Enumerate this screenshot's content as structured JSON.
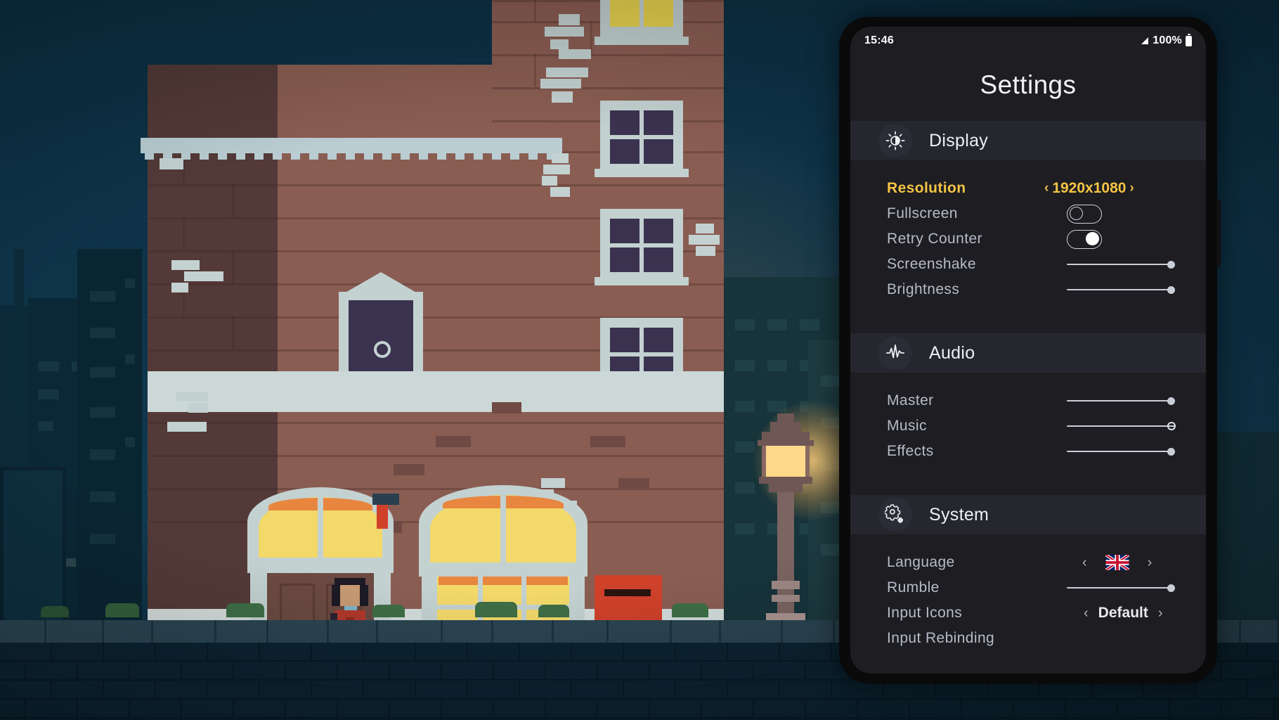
{
  "phone": {
    "status": {
      "time": "15:46",
      "battery": "100%",
      "signal_icon": "signal-icon",
      "battery_icon": "battery-icon"
    },
    "title": "Settings"
  },
  "sections": [
    {
      "id": "display",
      "label": "Display",
      "icon": "brightness-icon",
      "rows": [
        {
          "label": "Resolution",
          "type": "stepper",
          "value": "1920x1080",
          "active": true,
          "prev": "‹",
          "next": "›"
        },
        {
          "label": "Fullscreen",
          "type": "toggle",
          "value": "off"
        },
        {
          "label": "Retry Counter",
          "type": "toggle",
          "value": "on"
        },
        {
          "label": "Screenshake",
          "type": "slider",
          "value": 100
        },
        {
          "label": "Brightness",
          "type": "slider",
          "value": 100
        }
      ]
    },
    {
      "id": "audio",
      "label": "Audio",
      "icon": "waveform-icon",
      "rows": [
        {
          "label": "Master",
          "type": "slider",
          "value": 100
        },
        {
          "label": "Music",
          "type": "slider",
          "value": 100,
          "knob": "hollow"
        },
        {
          "label": "Effects",
          "type": "slider",
          "value": 100
        }
      ]
    },
    {
      "id": "system",
      "label": "System",
      "icon": "gear-icon",
      "rows": [
        {
          "label": "Language",
          "type": "flag-stepper",
          "value": "uk-flag",
          "prev": "‹",
          "next": "›"
        },
        {
          "label": "Rumble",
          "type": "slider",
          "value": 100
        },
        {
          "label": "Input Icons",
          "type": "stepper-plain",
          "value": "Default",
          "prev": "‹",
          "next": "›"
        },
        {
          "label": "Input Rebinding",
          "type": "none"
        }
      ]
    }
  ],
  "colors": {
    "accent": "#f5c445",
    "label": "#b6bcc6",
    "heading": "#eef0f3",
    "screen_bg": "#1d1d22",
    "section_band": "#26262e",
    "sky": "#0e3449",
    "brick": "#8a5d52",
    "window_lit": "#e8d34f",
    "window_dark": "#3b3250",
    "trim": "#c3d1d1",
    "mailbox_red": "#d0412a",
    "lamp_glow": "#ffd98a"
  },
  "scene": {
    "name": "pixel-art-night-street",
    "description": "Night city street with brick apartment building, lit shopfront, character, mailbox and street lamp"
  }
}
